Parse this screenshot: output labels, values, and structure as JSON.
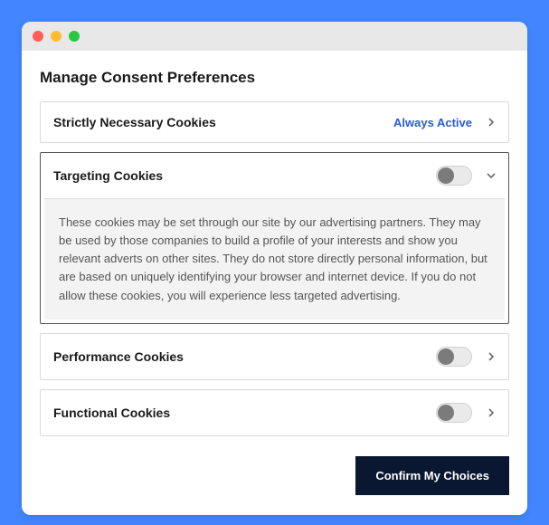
{
  "title": "Manage Consent Preferences",
  "always_active_label": "Always Active",
  "sections": {
    "necessary": {
      "title": "Strictly Necessary Cookies"
    },
    "targeting": {
      "title": "Targeting Cookies",
      "body": "These cookies may be set through our site by our advertising partners. They may be used by those companies to build a profile of your interests and show you relevant adverts on other sites. They do not store directly personal information, but are based on uniquely identifying your browser and internet device. If you do not allow these cookies, you will experience less targeted advertising."
    },
    "performance": {
      "title": "Performance Cookies"
    },
    "functional": {
      "title": "Functional Cookies"
    }
  },
  "confirm_label": "Confirm My Choices",
  "colors": {
    "accent": "#2a5bd7",
    "button_bg": "#0a1730",
    "page_bg": "#4285ff"
  }
}
